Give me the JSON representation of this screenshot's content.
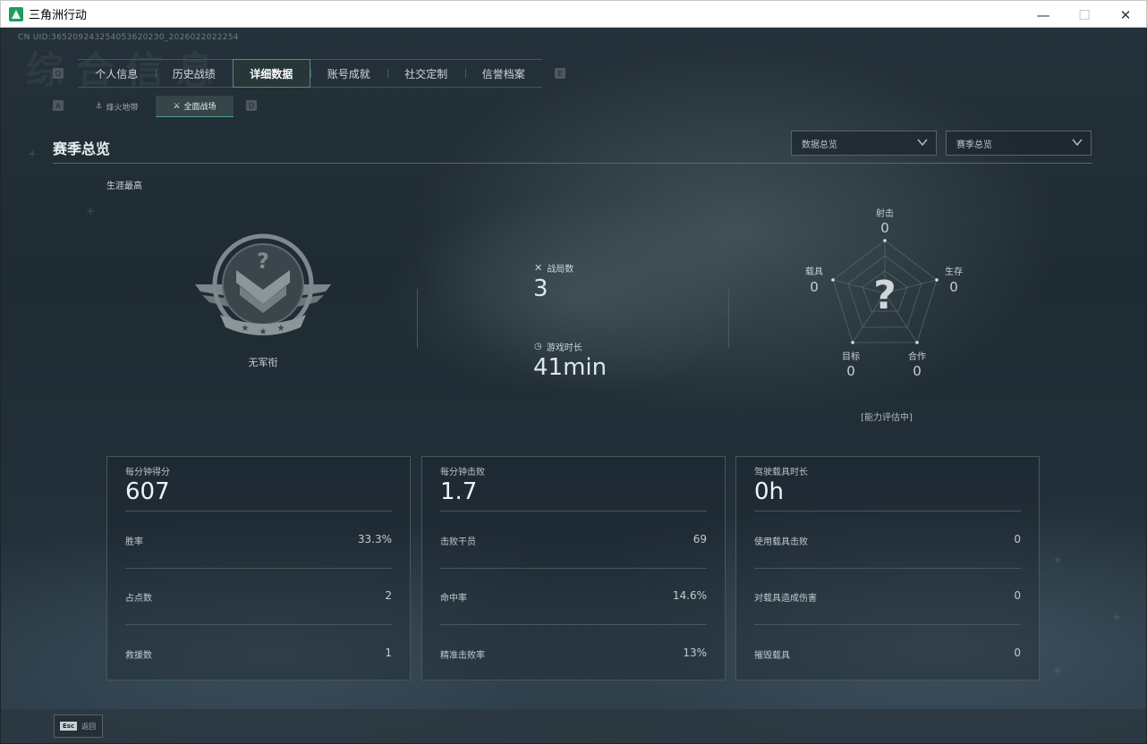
{
  "window": {
    "title": "三角洲行动",
    "minimize": "—",
    "restore": "☐",
    "close": "✕"
  },
  "uid": "CN UID:365209243254053620230_2026022022254",
  "ghost_title": "综合信息",
  "top_tabs": {
    "left_key": "Q",
    "right_key": "E",
    "items": [
      {
        "label": "个人信息"
      },
      {
        "label": "历史战绩"
      },
      {
        "label": "详细数据"
      },
      {
        "label": "账号成就"
      },
      {
        "label": "社交定制"
      },
      {
        "label": "信誉档案"
      }
    ],
    "active_index": 2
  },
  "sub_tabs": {
    "left_key": "A",
    "right_key": "D",
    "items": [
      {
        "label": "烽火地带",
        "icon": "anchor-icon"
      },
      {
        "label": "全面战场",
        "icon": "battle-icon"
      }
    ],
    "active_index": 1
  },
  "section": {
    "title": "赛季总览",
    "dropdown_data": "数据总览",
    "dropdown_season": "赛季总览"
  },
  "career": {
    "label": "生涯最高",
    "rank_name": "无军衔",
    "rank_icon": "rank-emblem-icon"
  },
  "summary": {
    "matches_label": "战局数",
    "matches_value": "3",
    "playtime_label": "游戏时长",
    "playtime_value": "41min"
  },
  "radar": {
    "center_mark": "?",
    "note": "[能力评估中]",
    "axes": [
      {
        "label": "射击",
        "value": "0"
      },
      {
        "label": "生存",
        "value": "0"
      },
      {
        "label": "合作",
        "value": "0"
      },
      {
        "label": "目标",
        "value": "0"
      },
      {
        "label": "载具",
        "value": "0"
      }
    ]
  },
  "cards": [
    {
      "title": "每分钟得分",
      "big": "607",
      "rows": [
        {
          "label": "胜率",
          "value": "33.3%"
        },
        {
          "label": "占点数",
          "value": "2"
        },
        {
          "label": "救援数",
          "value": "1"
        }
      ]
    },
    {
      "title": "每分钟击败",
      "big": "1.7",
      "rows": [
        {
          "label": "击败干员",
          "value": "69"
        },
        {
          "label": "命中率",
          "value": "14.6%"
        },
        {
          "label": "精准击败率",
          "value": "13%"
        }
      ]
    },
    {
      "title": "驾驶载具时长",
      "big": "0h",
      "rows": [
        {
          "label": "使用载具击败",
          "value": "0"
        },
        {
          "label": "对载具造成伤害",
          "value": "0"
        },
        {
          "label": "摧毁载具",
          "value": "0"
        }
      ]
    }
  ],
  "footer": {
    "esc_key": "Esc",
    "esc_label": "返回"
  },
  "colors": {
    "accent": "#4f8f76",
    "background": "#1f2b33",
    "text": "#c9d2d6"
  }
}
